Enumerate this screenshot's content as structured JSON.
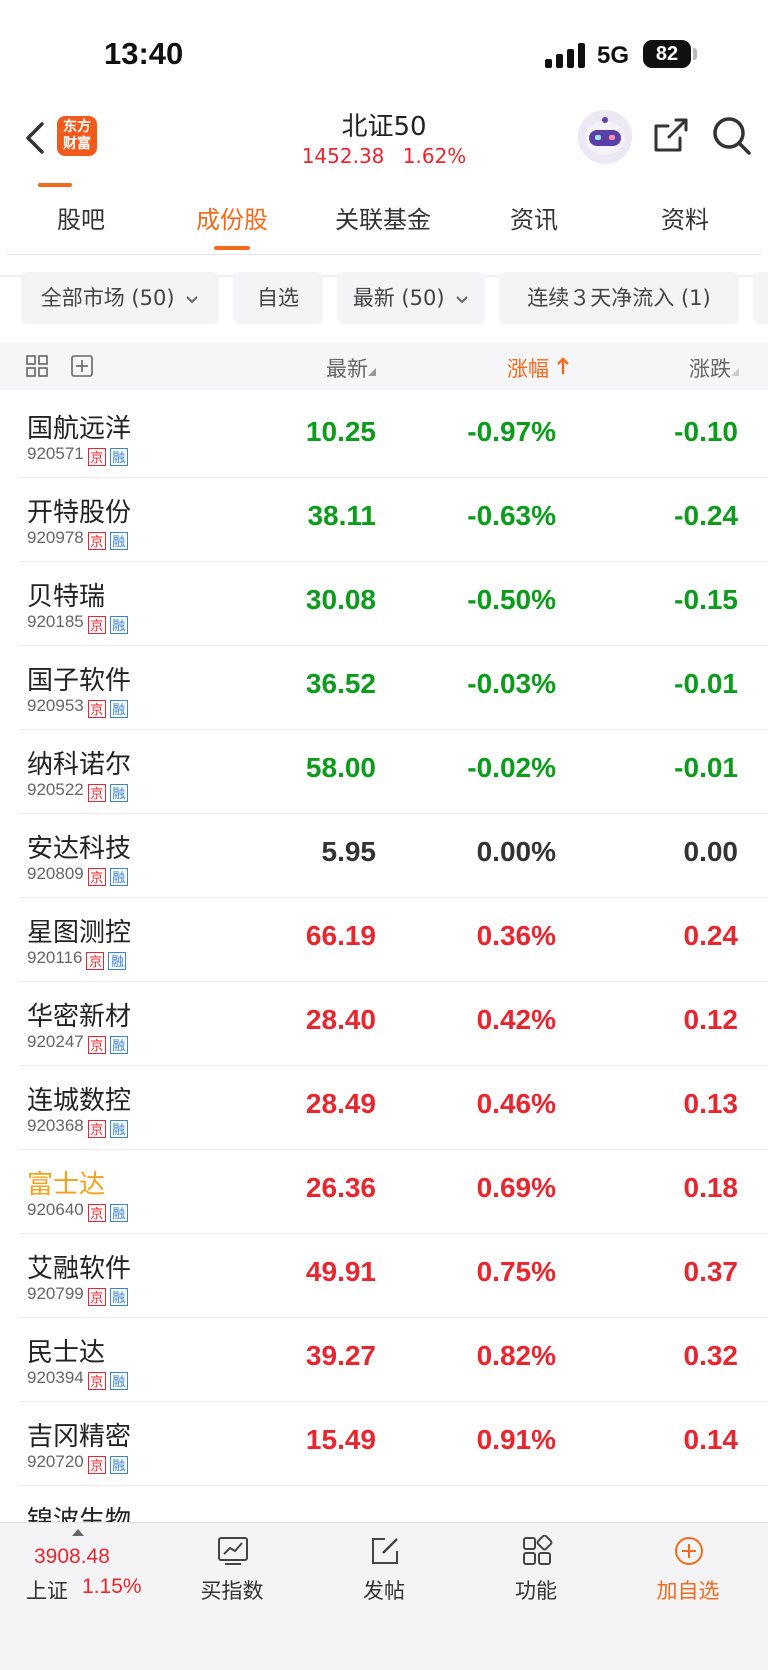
{
  "status_bar": {
    "time": "13:40",
    "network": "5G",
    "battery": "82"
  },
  "header": {
    "title": "北证50",
    "index_value": "1452.38",
    "index_change_pct": "1.62%",
    "logo_text": "东方财富"
  },
  "tabs": [
    {
      "label": "股吧"
    },
    {
      "label": "成份股"
    },
    {
      "label": "关联基金"
    },
    {
      "label": "资讯"
    },
    {
      "label": "资料"
    }
  ],
  "active_tab": "成份股",
  "filters": [
    {
      "label": "全部市场 (50)",
      "dropdown": true
    },
    {
      "label": "自选",
      "dropdown": false
    },
    {
      "label": "最新 (50)",
      "dropdown": true
    },
    {
      "label": "连续３天净流入 (1)",
      "dropdown": false
    }
  ],
  "columns": {
    "latest": "最新",
    "change_pct": "涨幅",
    "change": "涨跌"
  },
  "sort": {
    "column": "change_pct",
    "direction": "ascending"
  },
  "stocks": [
    {
      "name": "国航远洋",
      "code": "920571",
      "price": "10.25",
      "pct": "-0.97%",
      "chg": "-0.10",
      "trend": "down"
    },
    {
      "name": "开特股份",
      "code": "920978",
      "price": "38.11",
      "pct": "-0.63%",
      "chg": "-0.24",
      "trend": "down"
    },
    {
      "name": "贝特瑞",
      "code": "920185",
      "price": "30.08",
      "pct": "-0.50%",
      "chg": "-0.15",
      "trend": "down"
    },
    {
      "name": "国子软件",
      "code": "920953",
      "price": "36.52",
      "pct": "-0.03%",
      "chg": "-0.01",
      "trend": "down"
    },
    {
      "name": "纳科诺尔",
      "code": "920522",
      "price": "58.00",
      "pct": "-0.02%",
      "chg": "-0.01",
      "trend": "down"
    },
    {
      "name": "安达科技",
      "code": "920809",
      "price": "5.95",
      "pct": "0.00%",
      "chg": "0.00",
      "trend": "flat"
    },
    {
      "name": "星图测控",
      "code": "920116",
      "price": "66.19",
      "pct": "0.36%",
      "chg": "0.24",
      "trend": "up"
    },
    {
      "name": "华密新材",
      "code": "920247",
      "price": "28.40",
      "pct": "0.42%",
      "chg": "0.12",
      "trend": "up"
    },
    {
      "name": "连城数控",
      "code": "920368",
      "price": "28.49",
      "pct": "0.46%",
      "chg": "0.13",
      "trend": "up"
    },
    {
      "name": "富士达",
      "code": "920640",
      "price": "26.36",
      "pct": "0.69%",
      "chg": "0.18",
      "trend": "up",
      "highlight": true
    },
    {
      "name": "艾融软件",
      "code": "920799",
      "price": "49.91",
      "pct": "0.75%",
      "chg": "0.37",
      "trend": "up"
    },
    {
      "name": "民士达",
      "code": "920394",
      "price": "39.27",
      "pct": "0.82%",
      "chg": "0.32",
      "trend": "up"
    },
    {
      "name": "吉冈精密",
      "code": "920720",
      "price": "15.49",
      "pct": "0.91%",
      "chg": "0.14",
      "trend": "up"
    },
    {
      "name": "锦波生物",
      "code": "",
      "price": "",
      "pct": "",
      "chg": "",
      "trend": "up",
      "partial": true
    }
  ],
  "tags": {
    "exchange": "京",
    "margin": "融"
  },
  "bottom_bar": {
    "market_index": {
      "name": "上证",
      "value": "3908.48",
      "change_pct": "1.15%"
    },
    "nav": [
      {
        "label": "买指数",
        "icon": "chart-icon"
      },
      {
        "label": "发帖",
        "icon": "edit-icon"
      },
      {
        "label": "功能",
        "icon": "apps-icon"
      },
      {
        "label": "加自选",
        "icon": "add-circle-icon"
      }
    ]
  },
  "colors": {
    "up": "#e8262f",
    "down": "#0c9b1c",
    "accent": "#f26a1c",
    "highlight": "#f2a21c"
  }
}
